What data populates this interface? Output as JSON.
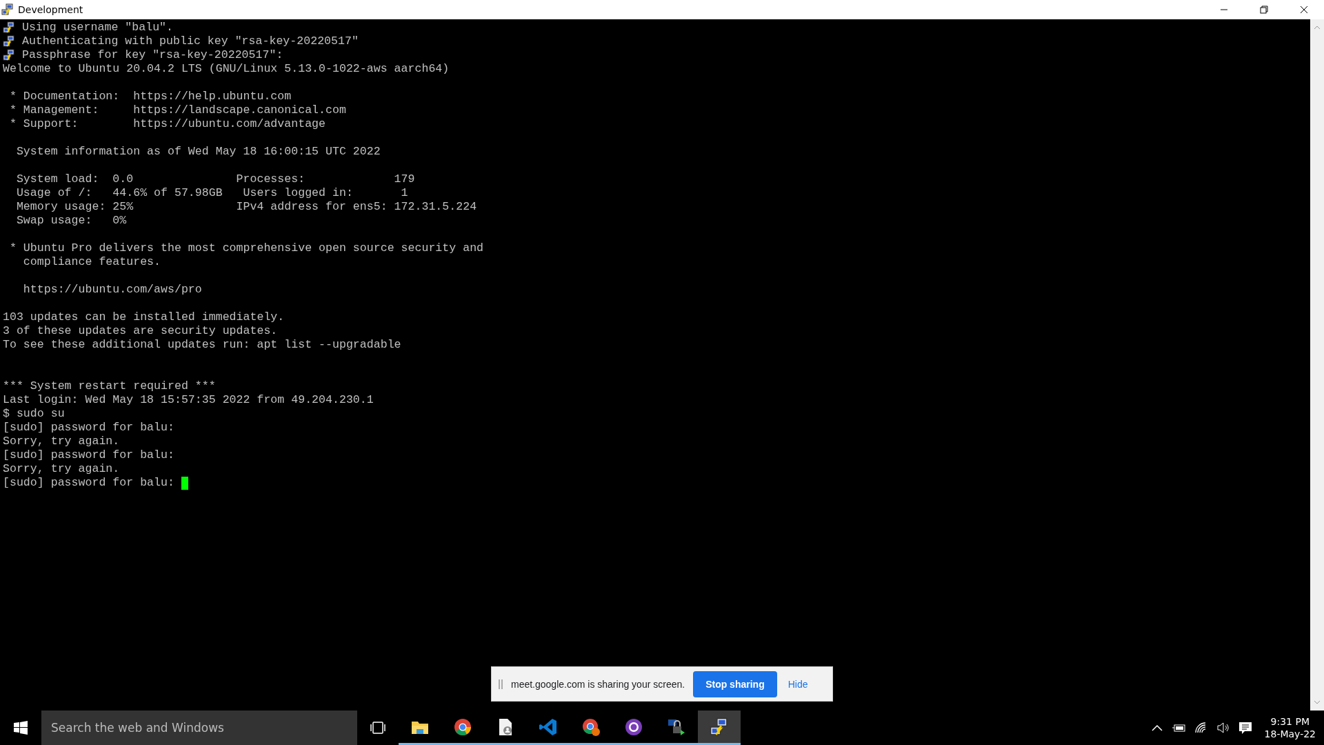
{
  "window": {
    "title": "Development"
  },
  "terminal": {
    "lines": [
      {
        "kind": "info",
        "text": "Using username \"balu\"."
      },
      {
        "kind": "info",
        "text": "Authenticating with public key \"rsa-key-20220517\""
      },
      {
        "kind": "info",
        "text": "Passphrase for key \"rsa-key-20220517\":"
      },
      {
        "kind": "text",
        "text": "Welcome to Ubuntu 20.04.2 LTS (GNU/Linux 5.13.0-1022-aws aarch64)"
      },
      {
        "kind": "blank"
      },
      {
        "kind": "text",
        "text": " * Documentation:  https://help.ubuntu.com"
      },
      {
        "kind": "text",
        "text": " * Management:     https://landscape.canonical.com"
      },
      {
        "kind": "text",
        "text": " * Support:        https://ubuntu.com/advantage"
      },
      {
        "kind": "blank"
      },
      {
        "kind": "text",
        "text": "  System information as of Wed May 18 16:00:15 UTC 2022"
      },
      {
        "kind": "blank"
      },
      {
        "kind": "text",
        "text": "  System load:  0.0               Processes:             179"
      },
      {
        "kind": "text",
        "text": "  Usage of /:   44.6% of 57.98GB   Users logged in:       1"
      },
      {
        "kind": "text",
        "text": "  Memory usage: 25%               IPv4 address for ens5: 172.31.5.224"
      },
      {
        "kind": "text",
        "text": "  Swap usage:   0%"
      },
      {
        "kind": "blank"
      },
      {
        "kind": "text",
        "text": " * Ubuntu Pro delivers the most comprehensive open source security and"
      },
      {
        "kind": "text",
        "text": "   compliance features."
      },
      {
        "kind": "blank"
      },
      {
        "kind": "text",
        "text": "   https://ubuntu.com/aws/pro"
      },
      {
        "kind": "blank"
      },
      {
        "kind": "text",
        "text": "103 updates can be installed immediately."
      },
      {
        "kind": "text",
        "text": "3 of these updates are security updates."
      },
      {
        "kind": "text",
        "text": "To see these additional updates run: apt list --upgradable"
      },
      {
        "kind": "blank"
      },
      {
        "kind": "blank"
      },
      {
        "kind": "text",
        "text": "*** System restart required ***"
      },
      {
        "kind": "text",
        "text": "Last login: Wed May 18 15:57:35 2022 from 49.204.230.1"
      },
      {
        "kind": "text",
        "text": "$ sudo su"
      },
      {
        "kind": "text",
        "text": "[sudo] password for balu:"
      },
      {
        "kind": "text",
        "text": "Sorry, try again."
      },
      {
        "kind": "text",
        "text": "[sudo] password for balu:"
      },
      {
        "kind": "text",
        "text": "Sorry, try again."
      },
      {
        "kind": "prompt",
        "text": "[sudo] password for balu: "
      }
    ]
  },
  "share_bar": {
    "message": "meet.google.com is sharing your screen.",
    "stop_button": "Stop sharing",
    "hide_link": "Hide"
  },
  "taskbar": {
    "search": {
      "placeholder": "Search the web and Windows"
    },
    "apps": [
      {
        "kind": "folder",
        "selected": false
      },
      {
        "kind": "chrome",
        "selected": false
      },
      {
        "kind": "document",
        "selected": false
      },
      {
        "kind": "code",
        "selected": false
      },
      {
        "kind": "chrome-badge",
        "selected": false
      },
      {
        "kind": "github",
        "selected": false
      },
      {
        "kind": "lock",
        "selected": false
      },
      {
        "kind": "putty",
        "selected": true
      }
    ],
    "time": "9:31 PM",
    "date": "18-May-22"
  }
}
